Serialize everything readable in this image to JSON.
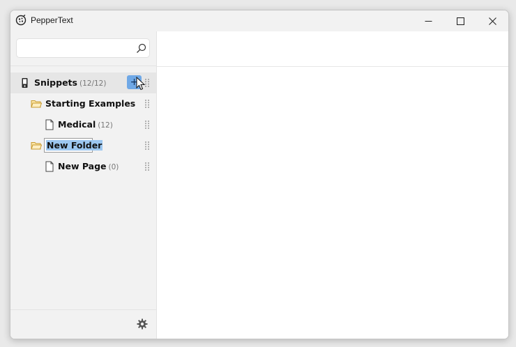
{
  "app": {
    "title": "PepperText",
    "icon": "pepper-logo-icon"
  },
  "window_controls": [
    "minimize-icon",
    "maximize-icon",
    "close-icon"
  ],
  "search": {
    "value": "",
    "placeholder": "",
    "icon": "search-icon"
  },
  "tree": {
    "root": {
      "label": "Snippets",
      "count": "(12/12)",
      "icon": "phone-icon",
      "add_label": "+"
    },
    "items": [
      {
        "label": "Starting Examples",
        "count": "",
        "icon": "folder-icon"
      },
      {
        "label": "Medical",
        "count": "(12)",
        "icon": "page-icon"
      },
      {
        "label": "New Folder",
        "count": "",
        "icon": "folder-icon",
        "editing": true
      },
      {
        "label": "New Page",
        "count": "(0)",
        "icon": "page-icon"
      }
    ]
  },
  "footer": {
    "icon": "gear-icon"
  },
  "colors": {
    "accent": "#6fa8e6",
    "selection": "#9cc7f0",
    "sidebar_bg": "#f2f2f2",
    "folder": "#c89a2e"
  }
}
